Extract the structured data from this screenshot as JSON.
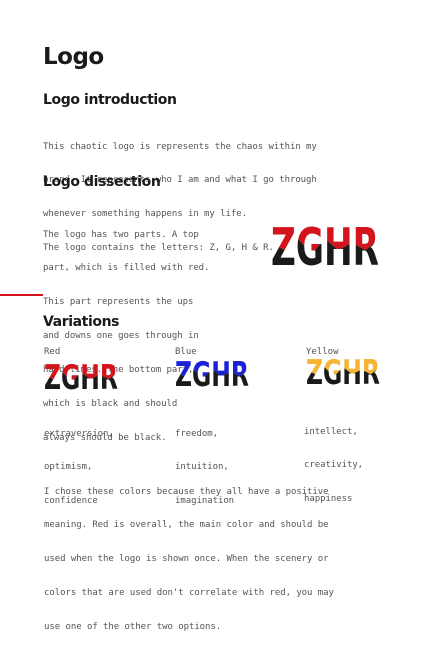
{
  "page": {
    "title": "Logo"
  },
  "intro": {
    "heading": "Logo introduction",
    "lines": [
      "This chaotic logo is represents the chaos within my",
      "brand. It represents who I am and what I go through",
      "whenever something happens in my life.",
      "The logo contains the letters: Z, G, H & R."
    ]
  },
  "dissection": {
    "heading": "Logo dissection",
    "lines": [
      "The logo has two parts. A top",
      "part, which is filled with red.",
      "This part represents the ups",
      "and downs one goes through in",
      "hard times. The bottom part,",
      "which is black and should",
      "always should be black."
    ],
    "logo_text": "ZGHR",
    "logo_color": "#d4141c"
  },
  "variations": {
    "heading": "Variations",
    "items": [
      {
        "name": "Red",
        "logo_text": "ZGHR",
        "color": "#d4141c",
        "traits": [
          "extraversion,",
          "optimism,",
          "confidence"
        ]
      },
      {
        "name": "Blue",
        "logo_text": "ZGHR",
        "color": "#1a22d8",
        "traits": [
          "freedom,",
          "intuition,",
          "imagination"
        ]
      },
      {
        "name": "Yellow",
        "logo_text": "ZGHR",
        "color": "#f5b432",
        "traits": [
          "intellect,",
          "creativity,",
          "happiness"
        ]
      }
    ],
    "conclusion_lines": [
      "I chose these colors because they all have a positive",
      "meaning. Red is overall, the main color and should be",
      "used when the logo is shown once. When the scenery or",
      "colors that are used don't correlate with red, you may",
      "use one of the other two options."
    ]
  },
  "colors": {
    "accent": "#d4141c",
    "black": "#1a1a1a"
  }
}
